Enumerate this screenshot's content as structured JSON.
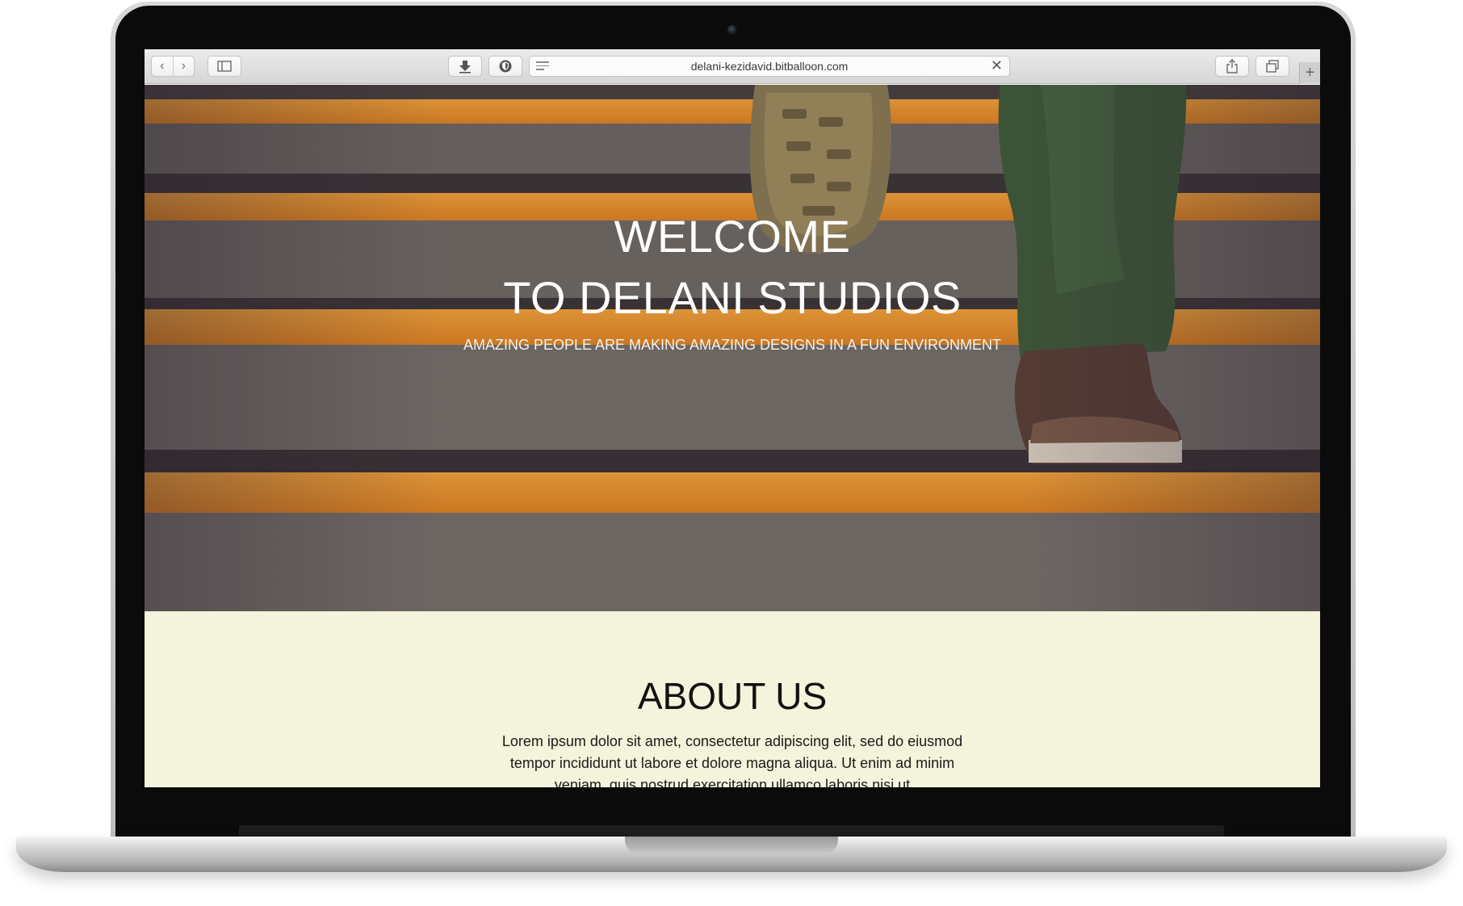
{
  "browser": {
    "url": "delani-kezidavid.bitballoon.com",
    "icons": {
      "back": "chevron-left-icon",
      "forward": "chevron-right-icon",
      "sidebar": "sidebar-icon",
      "download": "download-icon",
      "shield": "shield-icon",
      "reader": "reader-icon",
      "close": "close-icon",
      "share": "share-icon",
      "tabs": "tabs-icon",
      "new_tab": "plus-icon"
    }
  },
  "hero": {
    "title_line1": "WELCOME",
    "title_line2": "TO DELANI STUDIOS",
    "subtitle": "AMAZING PEOPLE ARE MAKING AMAZING DESIGNS IN A FUN ENVIRONMENT"
  },
  "about": {
    "title": "ABOUT US",
    "text": "Lorem ipsum dolor sit amet, consectetur adipiscing elit, sed do eiusmod tempor incididunt ut labore et dolore magna aliqua. Ut enim ad minim veniam, quis nostrud exercitation ullamco laboris nisi ut"
  },
  "colors": {
    "stripe_orange": "#f2952b",
    "step_gray": "#6f6a66",
    "about_bg": "#f4f3db"
  }
}
